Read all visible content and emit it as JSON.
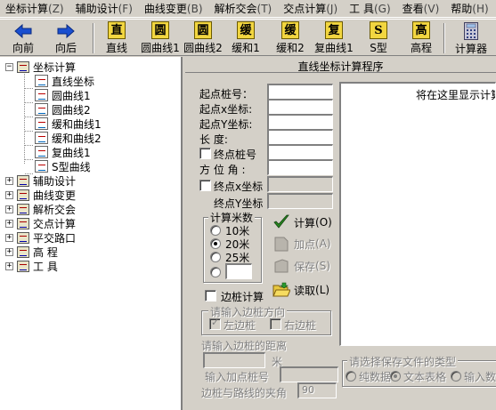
{
  "menu": [
    {
      "label": "坐标计算",
      "key": "(Z)"
    },
    {
      "label": "辅助设计",
      "key": "(F)"
    },
    {
      "label": "曲线变更",
      "key": "(B)"
    },
    {
      "label": "解析交会",
      "key": "(T)"
    },
    {
      "label": "交点计算",
      "key": "(J)"
    },
    {
      "label": "工  具",
      "key": "(G)"
    },
    {
      "label": "查看",
      "key": "(V)"
    },
    {
      "label": "帮助",
      "key": "(H)"
    }
  ],
  "toolbar": {
    "back": "向前",
    "forward": "向后",
    "straight": {
      "icon": "直",
      "label": "直线"
    },
    "curve1": {
      "icon": "圆",
      "label": "圆曲线1"
    },
    "curve2": {
      "icon": "圆",
      "label": "圆曲线2"
    },
    "ease1": {
      "icon": "缓",
      "label": "缓和1"
    },
    "ease2": {
      "icon": "缓",
      "label": "缓和2"
    },
    "compound1": {
      "icon": "复",
      "label": "复曲线1"
    },
    "stype": {
      "icon": "S",
      "label": "S型"
    },
    "elevation": {
      "icon": "高",
      "label": "高程"
    },
    "calculator": "计算器"
  },
  "tree": {
    "root": "坐标计算",
    "children": [
      "直线坐标",
      "圆曲线1",
      "圆曲线2",
      "缓和曲线1",
      "缓和曲线2",
      "复曲线1",
      "S型曲线"
    ],
    "others": [
      "辅助设计",
      "曲线变更",
      "解析交会",
      "交点计算",
      "平交路口",
      "高  程",
      "工  具"
    ]
  },
  "panel": {
    "title": "直线坐标计算程序",
    "start_station": "起点桩号：",
    "start_x": "起点x坐标:",
    "start_y": "起点Y坐标:",
    "length": "长    度:",
    "end_station_chk": "终点桩号",
    "azimuth": "方 位 角 :",
    "end_x_chk": "终点x坐标",
    "end_y": "终点Y坐标",
    "interval_group": "计算米数",
    "r10": "10米",
    "r20": "20米",
    "r25": "25米",
    "calc_btn": "计算",
    "calc_key": "(O)",
    "add_btn": "加点",
    "add_key": "(A)",
    "save_btn": "保存",
    "save_key": "(S)",
    "read_btn": "读取",
    "read_key": "(L)",
    "side_stake_chk": "边桩计算",
    "side_dir_group": "请输入边桩方向",
    "left_stake": "左边桩",
    "right_stake": "右边桩",
    "side_dist": "请输入边桩的距离",
    "meter": "米",
    "add_station": "输入加点桩号",
    "angle_label": "边桩与路线的夹角",
    "angle_value": "90",
    "save_type_group": "请选择保存文件的类型",
    "pure_data": "纯数据",
    "text_table": "文本表格",
    "input_data": "输入数",
    "output_hint": "将在这里显示计算"
  }
}
